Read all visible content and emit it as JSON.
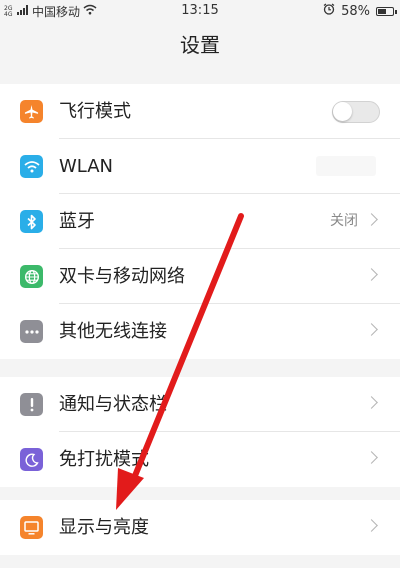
{
  "status_bar": {
    "signal_label": "2G 4G",
    "carrier": "中国移动",
    "time": "13:15",
    "battery_percent": "58%",
    "battery_level": 0.58
  },
  "header": {
    "title": "设置"
  },
  "groups": [
    {
      "items": [
        {
          "label": "飞行模式",
          "icon": "airplane-icon",
          "icon_color": "#f5842c",
          "control": "toggle",
          "toggle_on": false
        },
        {
          "label": "WLAN",
          "icon": "wifi-icon",
          "icon_color": "#2aaee8",
          "control": "value"
        },
        {
          "label": "蓝牙",
          "icon": "bluetooth-icon",
          "icon_color": "#2aaee8",
          "control": "chevron",
          "value": "关闭"
        },
        {
          "label": "双卡与移动网络",
          "icon": "globe-icon",
          "icon_color": "#3cb96a",
          "control": "chevron"
        },
        {
          "label": "其他无线连接",
          "icon": "more-icon",
          "icon_color": "#8f8f96",
          "control": "chevron"
        }
      ]
    },
    {
      "items": [
        {
          "label": "通知与状态栏",
          "icon": "exclamation-icon",
          "icon_color": "#8f8f96",
          "control": "chevron"
        },
        {
          "label": "免打扰模式",
          "icon": "moon-icon",
          "icon_color": "#7a62d8",
          "control": "chevron"
        }
      ]
    },
    {
      "items": [
        {
          "label": "显示与亮度",
          "icon": "display-icon",
          "icon_color": "#f5842c",
          "control": "chevron"
        }
      ]
    }
  ],
  "annotation": {
    "arrow_color": "#e21b1b"
  }
}
